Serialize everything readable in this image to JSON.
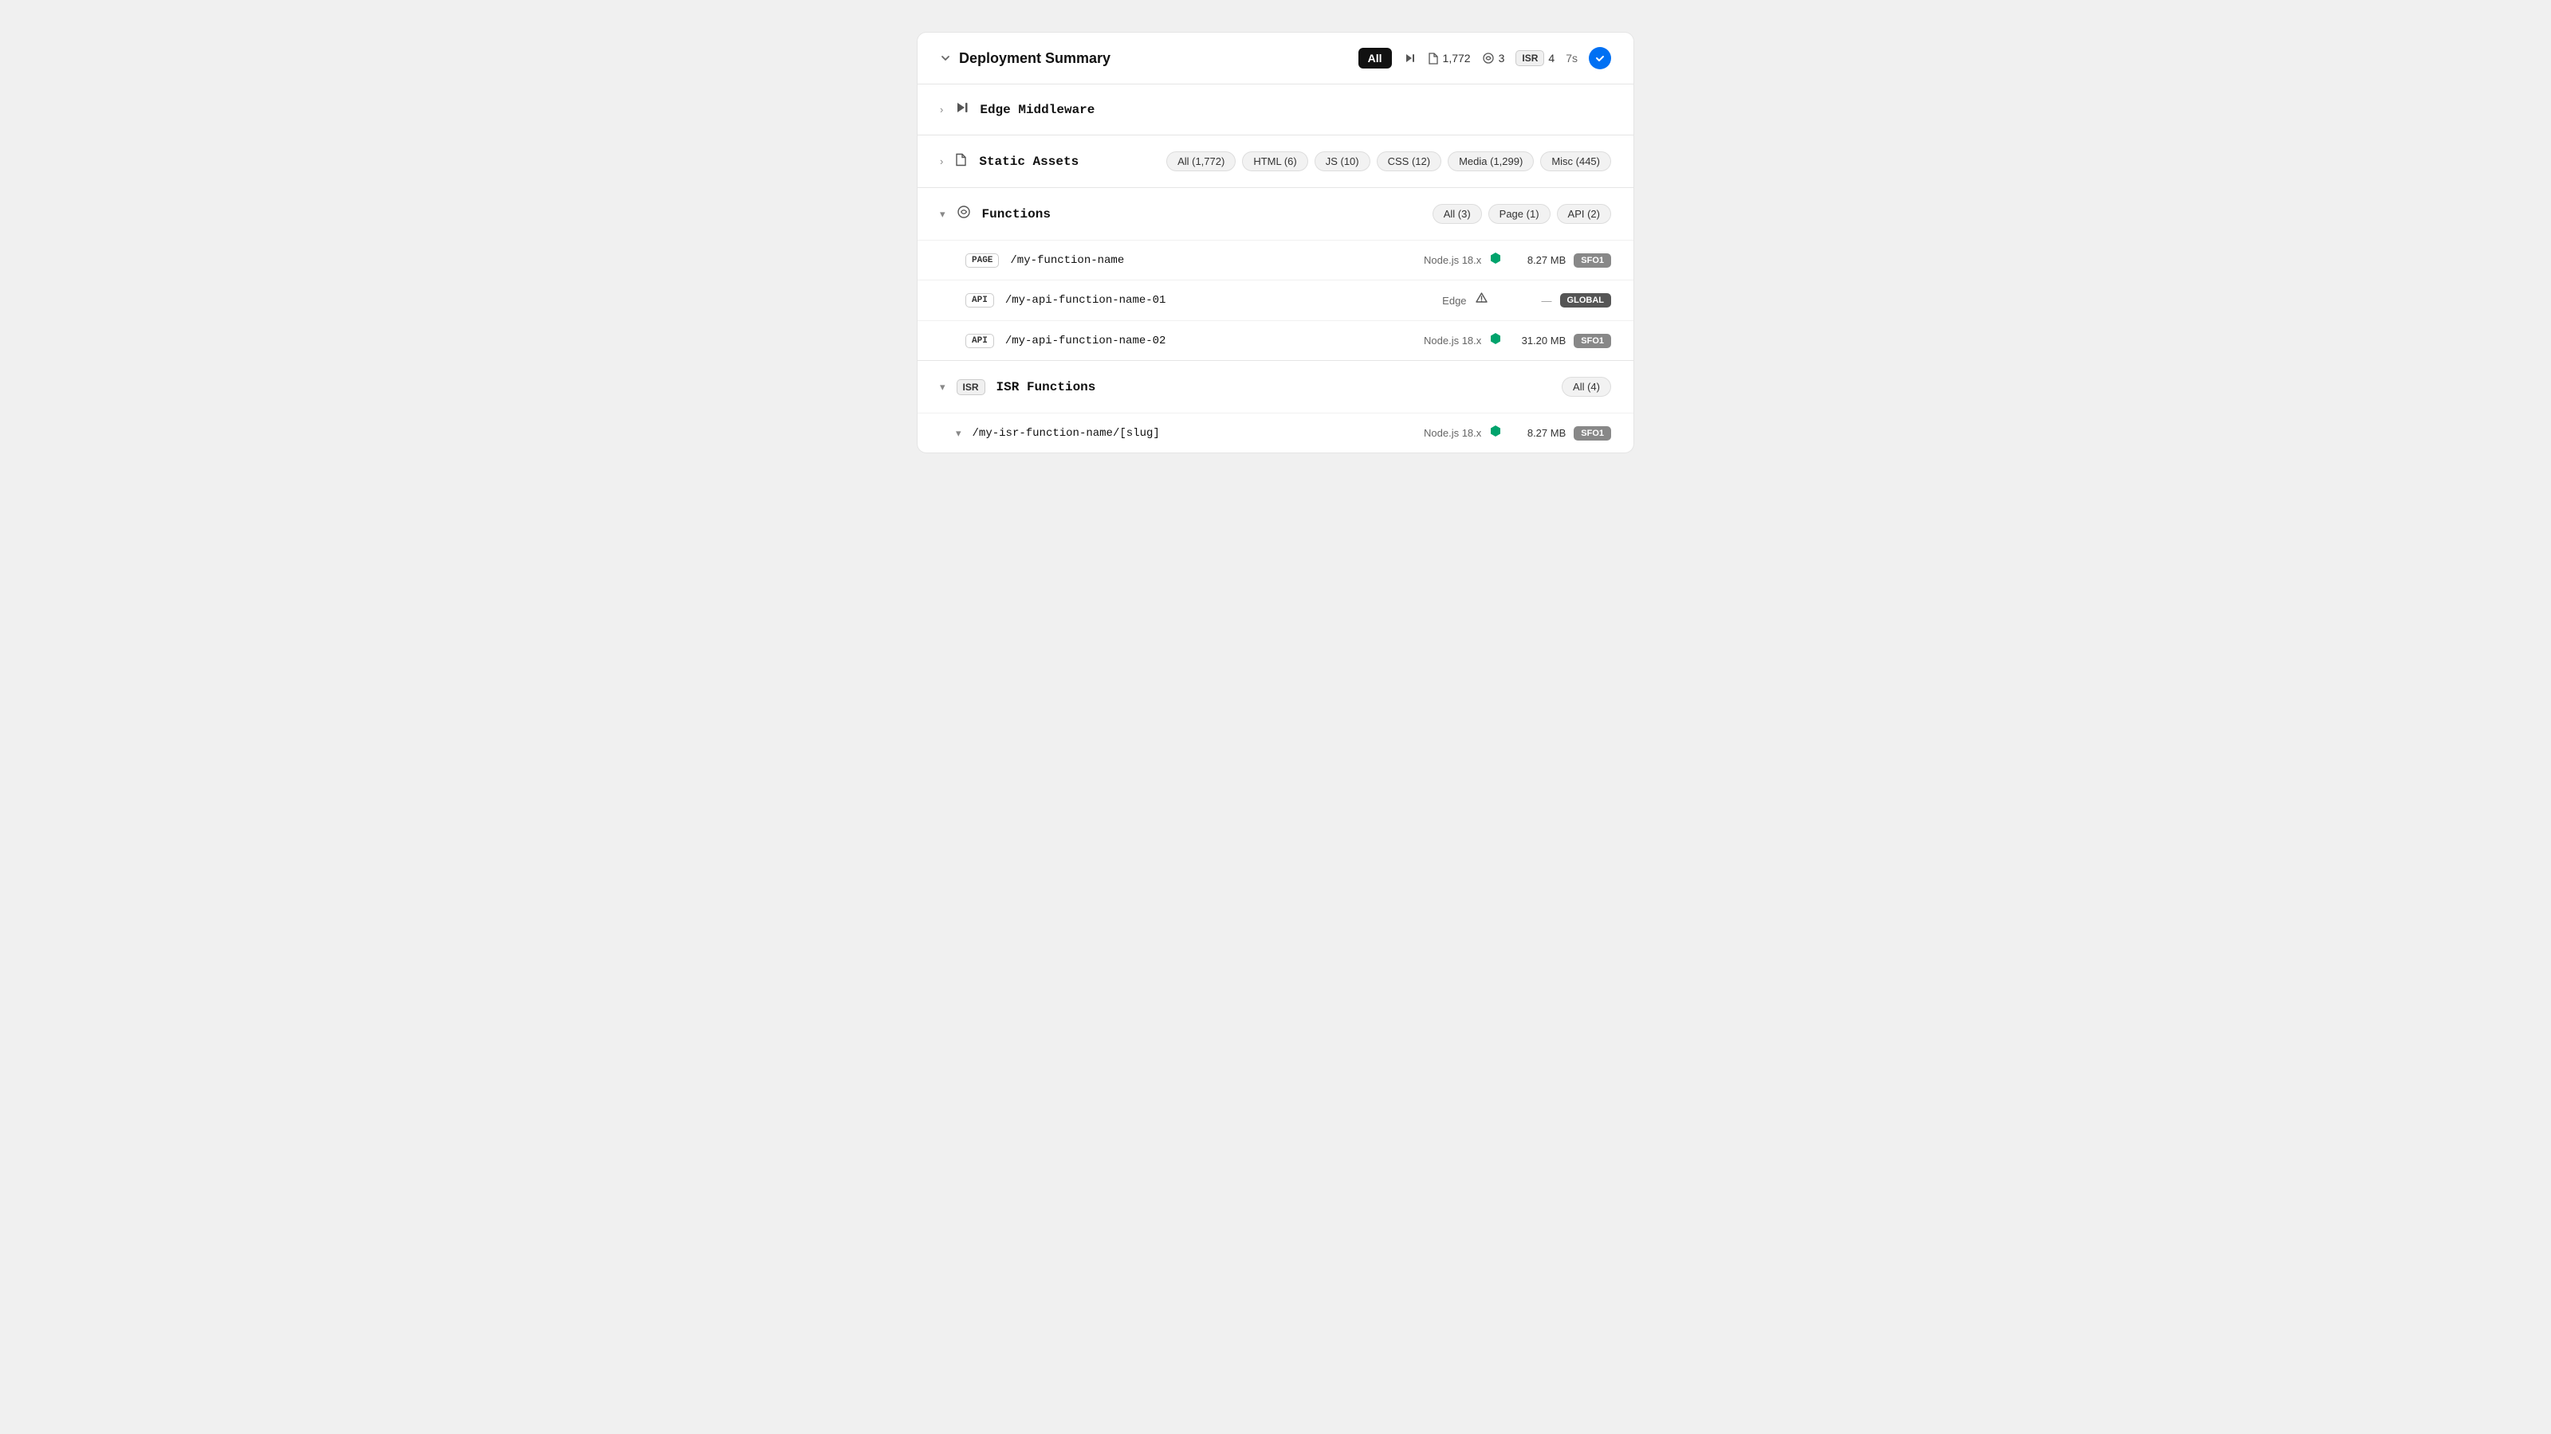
{
  "header": {
    "chevron": "▼",
    "title": "Deployment Summary",
    "all_label": "All",
    "stat_functions_icon": "⏯",
    "stat_static_count": "1,772",
    "stat_functions_count": "3",
    "isr_badge": "ISR",
    "isr_count": "4",
    "timer": "7s"
  },
  "sections": [
    {
      "id": "edge-middleware",
      "collapsed": true,
      "chevron": "›",
      "icon": "⏯",
      "title": "Edge Middleware",
      "filters": []
    },
    {
      "id": "static-assets",
      "collapsed": true,
      "chevron": "›",
      "icon": "☐",
      "title": "Static Assets",
      "filters": [
        {
          "label": "All (1,772)",
          "active": false
        },
        {
          "label": "HTML (6)",
          "active": false
        },
        {
          "label": "JS (10)",
          "active": false
        },
        {
          "label": "CSS (12)",
          "active": false
        },
        {
          "label": "Media (1,299)",
          "active": false
        },
        {
          "label": "Misc (445)",
          "active": false
        }
      ]
    },
    {
      "id": "functions",
      "collapsed": false,
      "chevron": "▾",
      "icon": "⌀",
      "title": "Functions",
      "filters": [
        {
          "label": "All (3)",
          "active": false
        },
        {
          "label": "Page (1)",
          "active": false
        },
        {
          "label": "API (2)",
          "active": false
        }
      ],
      "items": [
        {
          "type": "PAGE",
          "name": "/my-function-name",
          "runtime": "Node.js 18.x",
          "runtime_type": "node",
          "size": "8.27 MB",
          "region": "SFO1",
          "region_class": "region-sfo1"
        },
        {
          "type": "API",
          "name": "/my-api-function-name-01",
          "runtime": "Edge",
          "runtime_type": "edge",
          "size": null,
          "region": "GLOBAL",
          "region_class": "region-global"
        },
        {
          "type": "API",
          "name": "/my-api-function-name-02",
          "runtime": "Node.js 18.x",
          "runtime_type": "node",
          "size": "31.20 MB",
          "region": "SFO1",
          "region_class": "region-sfo1"
        }
      ]
    },
    {
      "id": "isr-functions",
      "collapsed": false,
      "chevron": "▾",
      "icon": "ISR",
      "title": "ISR Functions",
      "filters": [
        {
          "label": "All (4)",
          "active": false
        }
      ],
      "items": [
        {
          "type": null,
          "name": "/my-isr-function-name/[slug]",
          "runtime": "Node.js 18.x",
          "runtime_type": "node",
          "size": "8.27 MB",
          "region": "SFO1",
          "region_class": "region-sfo1",
          "collapsed": false
        }
      ]
    }
  ]
}
